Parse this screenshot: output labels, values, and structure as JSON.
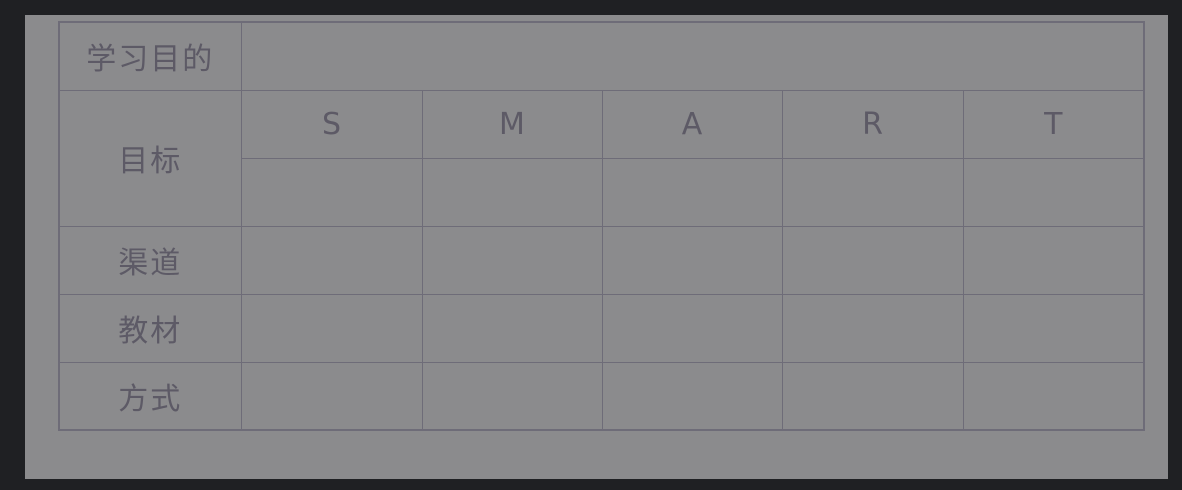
{
  "table": {
    "rows": {
      "purpose": "学习目的",
      "goal": "目标",
      "channel": "渠道",
      "material": "教材",
      "method": "方式"
    },
    "smart_columns": [
      "S",
      "M",
      "A",
      "R",
      "T"
    ]
  }
}
